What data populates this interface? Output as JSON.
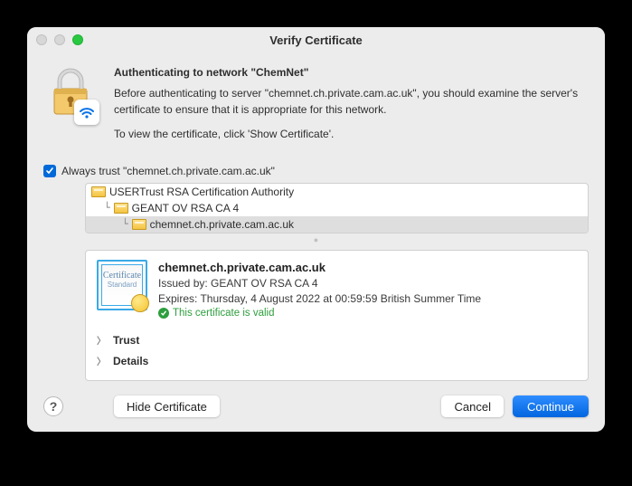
{
  "window": {
    "title": "Verify Certificate"
  },
  "intro": {
    "heading": "Authenticating to network \"ChemNet\"",
    "body": "Before authenticating to server \"chemnet.ch.private.cam.ac.uk\", you should examine the server's certificate to ensure that it is appropriate for this network.",
    "hint": "To view the certificate, click 'Show Certificate'."
  },
  "trust": {
    "checkbox_checked": true,
    "label": "Always trust \"chemnet.ch.private.cam.ac.uk\""
  },
  "tree": {
    "root": "USERTrust RSA Certification Authority",
    "level1": "GEANT OV RSA CA 4",
    "level2": "chemnet.ch.private.cam.ac.uk"
  },
  "cert": {
    "name": "chemnet.ch.private.cam.ac.uk",
    "issued_by": "Issued by: GEANT OV RSA CA 4",
    "expires": "Expires: Thursday, 4 August 2022 at 00:59:59 British Summer Time",
    "valid": "This certificate is valid",
    "badge_main": "Certificate",
    "badge_sub": "Standard"
  },
  "disclosures": {
    "trust": "Trust",
    "details": "Details"
  },
  "buttons": {
    "help": "?",
    "hide": "Hide Certificate",
    "cancel": "Cancel",
    "continue": "Continue"
  }
}
